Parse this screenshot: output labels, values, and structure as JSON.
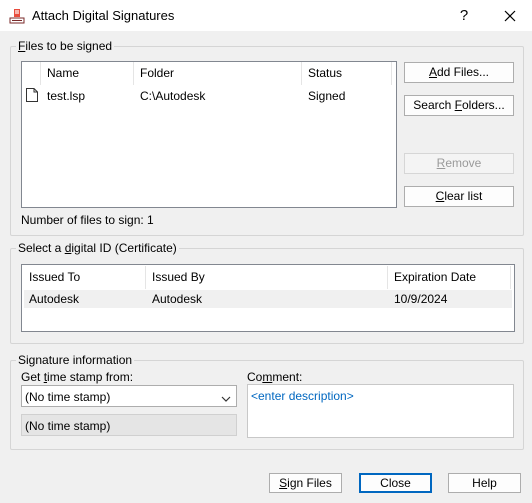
{
  "window": {
    "title": "Attach Digital Signatures",
    "help_glyph": "?",
    "app_icon": "signature-app-icon"
  },
  "files_group": {
    "label": "Files to be signed",
    "columns": [
      "Name",
      "Folder",
      "Status"
    ],
    "rows": [
      {
        "name": "test.lsp",
        "folder": "C:\\Autodesk",
        "status": "Signed"
      }
    ],
    "count_text": "Number of files to sign: 1",
    "buttons": {
      "add_files": "Add Files...",
      "search_folders": "Search Folders...",
      "remove": "Remove",
      "clear_list": "Clear list"
    }
  },
  "digital_id_group": {
    "label": "Select a digital ID (Certificate)",
    "columns": [
      "Issued To",
      "Issued By",
      "Expiration Date"
    ],
    "rows": [
      {
        "issued_to": "Autodesk",
        "issued_by": "Autodesk",
        "expiration": "10/9/2024"
      }
    ]
  },
  "signature_group": {
    "label": "Signature information",
    "timestamp_label": "Get time stamp from:",
    "timestamp_value": "(No time stamp)",
    "timestamp_display": "(No time stamp)",
    "comment_label": "Comment:",
    "comment_placeholder": "<enter description>"
  },
  "footer": {
    "sign_files": "Sign Files",
    "close": "Close",
    "help": "Help"
  },
  "colors": {
    "accent": "#0067c0",
    "selected_row": "#f0f0f0",
    "placeholder": "#0067c0"
  }
}
